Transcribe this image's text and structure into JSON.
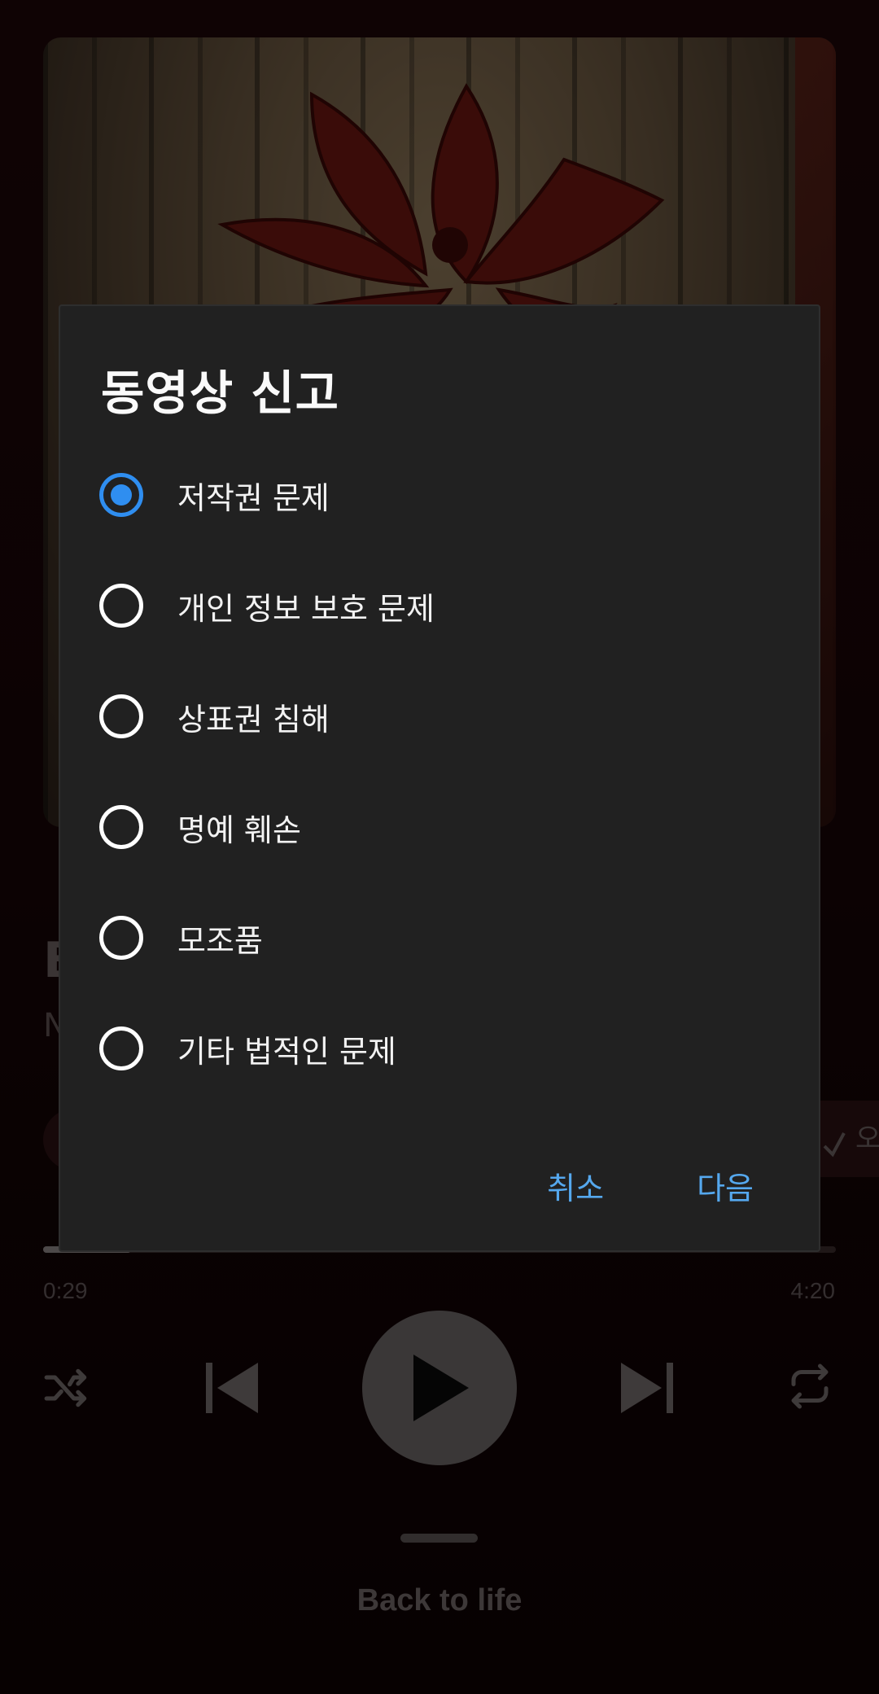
{
  "player": {
    "title_partial": "B",
    "artist_partial": "N",
    "save_partial": "오",
    "progress": 0.111,
    "time_elapsed": "0:29",
    "time_total": "4:20",
    "lyrics_tab_label": "Back to life"
  },
  "dialog": {
    "title": "동영상 신고",
    "options": [
      {
        "label": "저작권 문제",
        "checked": true
      },
      {
        "label": "개인 정보 보호 문제",
        "checked": false
      },
      {
        "label": "상표권 침해",
        "checked": false
      },
      {
        "label": "명예 훼손",
        "checked": false
      },
      {
        "label": "모조품",
        "checked": false
      },
      {
        "label": "기타 법적인 문제",
        "checked": false
      }
    ],
    "cancel_label": "취소",
    "next_label": "다음"
  },
  "colors": {
    "accent": "#2f8ef0",
    "action_text": "#55a8ee",
    "dialog_bg": "#212121"
  }
}
